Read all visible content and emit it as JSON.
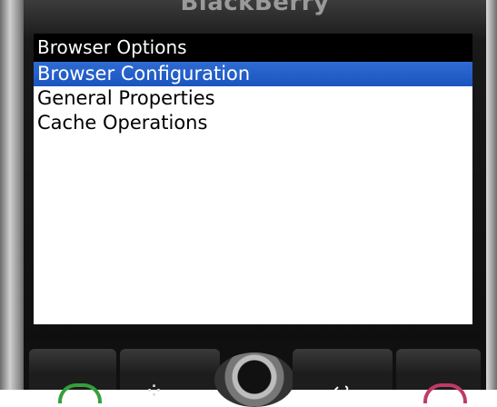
{
  "device": {
    "brand": "BlackBerry"
  },
  "screen": {
    "title": "Browser Options",
    "menu_items": [
      {
        "label": "Browser Configuration",
        "selected": true
      },
      {
        "label": "General Properties",
        "selected": false
      },
      {
        "label": "Cache Operations",
        "selected": false
      }
    ]
  },
  "keys": {
    "send_icon": "phone-send-icon",
    "menu_icon": "blackberry-menu-icon",
    "back_icon": "back-arrow-icon",
    "end_icon": "phone-end-icon"
  },
  "colors": {
    "selection": "#1f5fcb",
    "title_bar": "#000000",
    "send_key": "#35a03a",
    "end_key": "#c13a66"
  }
}
